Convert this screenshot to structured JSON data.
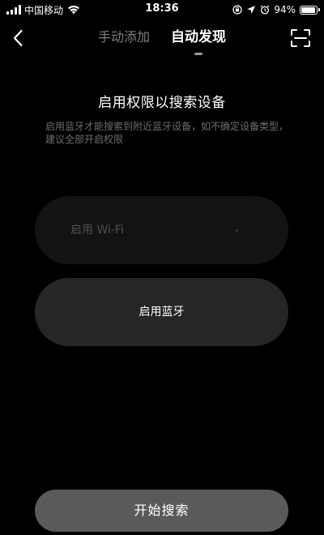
{
  "status_bar": {
    "carrier": "中国移动",
    "time": "18:36",
    "battery_percent_label": "94%",
    "battery_level": 0.94,
    "icons": [
      "signal-icon",
      "wifi-icon",
      "screen-rotation-lock-icon",
      "location-icon",
      "alarm-icon",
      "battery-icon"
    ]
  },
  "nav": {
    "back_icon": "chevron-left-icon",
    "tabs": [
      {
        "label": "手动添加",
        "active": false
      },
      {
        "label": "自动发现",
        "active": true
      }
    ],
    "scan_icon": "scan-frame-icon"
  },
  "main": {
    "title": "启用权限以搜索设备",
    "description": "启用蓝牙才能搜索到附近蓝牙设备，如不确定设备类型，建议全部开启权限",
    "wifi_button_label": "启用 Wi-Fi",
    "bluetooth_button_label": "启用蓝牙"
  },
  "footer": {
    "start_button_label": "开始搜索"
  },
  "colors": {
    "background": "#000000",
    "active_tab": "#ffffff",
    "inactive_tab": "#7d7d7d",
    "description_text": "#6e6e6e",
    "wifi_pill": "#131313",
    "bluetooth_pill": "#262626",
    "start_button": "#5a5a5a"
  }
}
